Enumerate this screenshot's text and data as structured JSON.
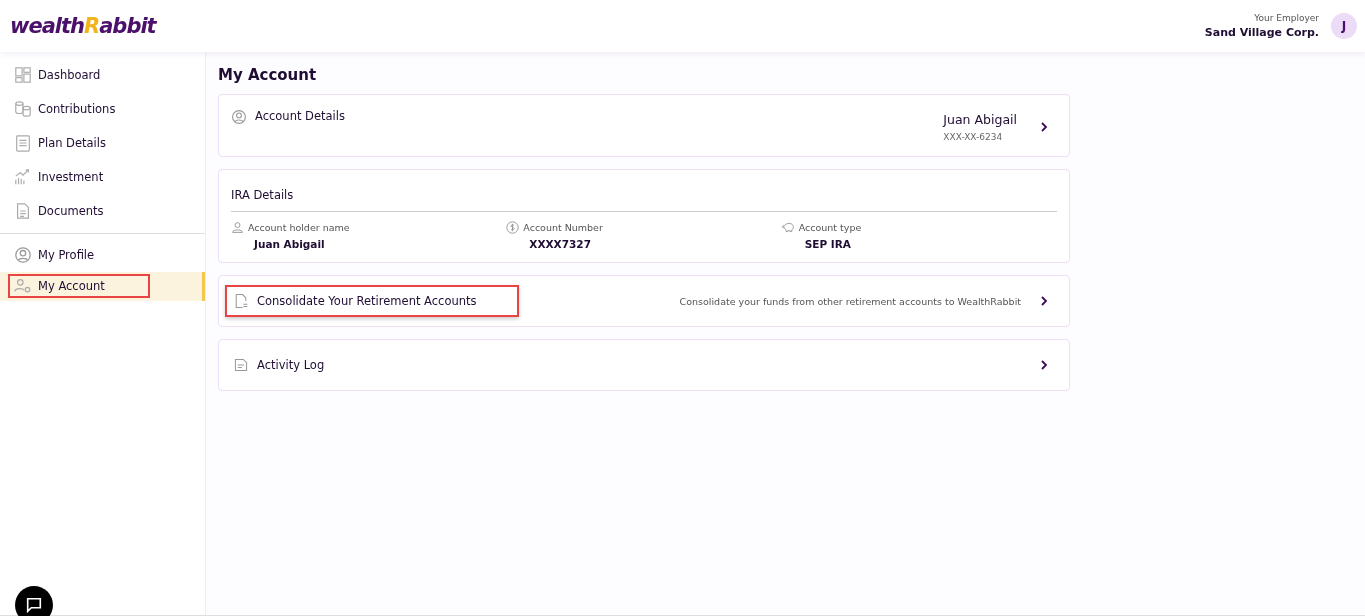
{
  "logo": [
    {
      "text": "wealth",
      "kind": "main"
    },
    {
      "text": "R",
      "kind": "accent"
    },
    {
      "text": "abbit",
      "kind": "main"
    }
  ],
  "employer": {
    "label": "Your Employer",
    "name": "Sand Village Corp.",
    "avatar": "J"
  },
  "sidebar": {
    "groups": [
      [
        {
          "label": "Dashboard",
          "kind": "dashboard",
          "selected": false,
          "highlighted": false
        },
        {
          "label": "Contributions",
          "kind": "coins",
          "selected": false,
          "highlighted": false
        },
        {
          "label": "Plan Details",
          "kind": "list",
          "selected": false,
          "highlighted": false
        },
        {
          "label": "Investment",
          "kind": "chart",
          "selected": false,
          "highlighted": false
        },
        {
          "label": "Documents",
          "kind": "document",
          "selected": false,
          "highlighted": false
        }
      ],
      [
        {
          "label": "My Profile",
          "kind": "profile",
          "selected": false,
          "highlighted": false
        },
        {
          "label": "My Account",
          "kind": "account",
          "selected": true,
          "highlighted": true
        }
      ]
    ]
  },
  "page_title": "My Account",
  "account_details": {
    "title": "Account Details",
    "name": "Juan Abigail",
    "ssn": "XXX-XX-6234"
  },
  "ira": {
    "title": "IRA Details",
    "fields": [
      {
        "label": "Account holder name",
        "value": "Juan Abigail",
        "kind": "person"
      },
      {
        "label": "Account Number",
        "value": "XXXX7327",
        "kind": "dollar"
      },
      {
        "label": "Account type",
        "value": "SEP IRA",
        "kind": "piggy"
      }
    ]
  },
  "rows": [
    {
      "title": "Consolidate Your Retirement Accounts",
      "description": "Consolidate your funds from other retirement accounts to WealthRabbit",
      "kind": "transfer",
      "highlighted": true
    },
    {
      "title": "Activity Log",
      "kind": "log",
      "highlighted": false
    }
  ]
}
